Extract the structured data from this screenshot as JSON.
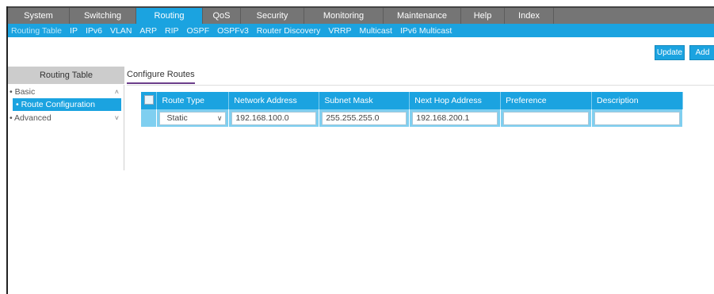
{
  "topnav": [
    {
      "label": "System"
    },
    {
      "label": "Switching"
    },
    {
      "label": "Routing"
    },
    {
      "label": "QoS"
    },
    {
      "label": "Security"
    },
    {
      "label": "Monitoring"
    },
    {
      "label": "Maintenance"
    },
    {
      "label": "Help"
    },
    {
      "label": "Index"
    }
  ],
  "subnav": [
    {
      "label": "Routing Table"
    },
    {
      "label": "IP"
    },
    {
      "label": "IPv6"
    },
    {
      "label": "VLAN"
    },
    {
      "label": "ARP"
    },
    {
      "label": "RIP"
    },
    {
      "label": "OSPF"
    },
    {
      "label": "OSPFv3"
    },
    {
      "label": "Router Discovery"
    },
    {
      "label": "VRRP"
    },
    {
      "label": "Multicast"
    },
    {
      "label": "IPv6 Multicast"
    }
  ],
  "buttons": {
    "update": "Update",
    "add": "Add"
  },
  "sidebar": {
    "header": "Routing Table",
    "items": [
      {
        "label": "• Basic"
      },
      {
        "label": "• Route Configuration"
      },
      {
        "label": "• Advanced"
      }
    ]
  },
  "tab": "Configure Routes",
  "table": {
    "headers": [
      "Route Type",
      "Network Address",
      "Subnet Mask",
      "Next Hop Address",
      "Preference",
      "Description"
    ],
    "row": {
      "route_type": "Static",
      "network_address": "192.168.100.0",
      "subnet_mask": "255.255.255.0",
      "next_hop": "192.168.200.1",
      "preference": "",
      "description": ""
    }
  },
  "colors": {
    "accent": "#1ba3e0",
    "nav_bg": "#757575",
    "row_bg": "#7fcff0",
    "tab_underline": "#6b3d8a"
  }
}
